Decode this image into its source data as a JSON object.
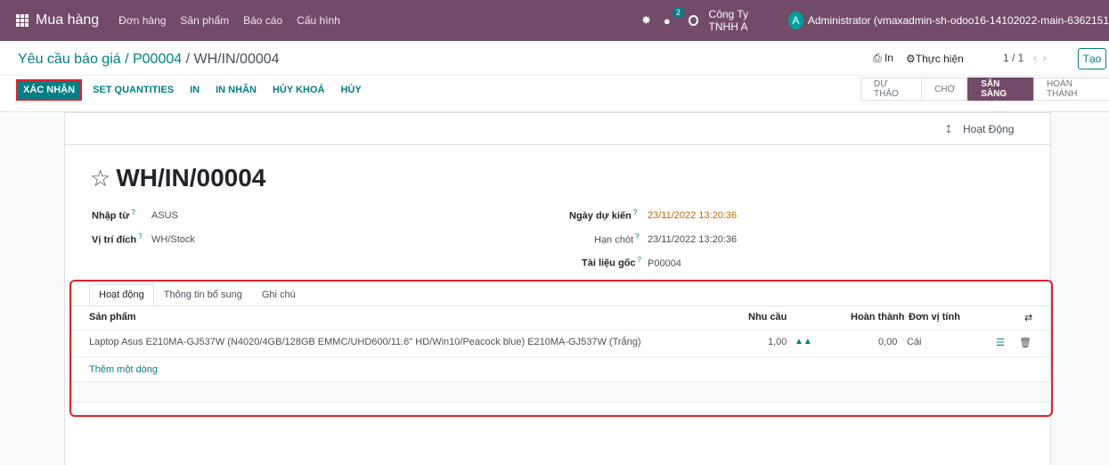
{
  "navbar": {
    "brand": "Mua hàng",
    "menus": [
      "Đơn hàng",
      "Sản phẩm",
      "Báo cáo",
      "Cấu hình"
    ],
    "chat_count": "2",
    "company": "Công Ty TNHH A",
    "avatar_letter": "A",
    "user": "Administrator (vmaxadmin-sh-odoo16-14102022-main-6362151"
  },
  "control_panel": {
    "breadcrumb_parent": "Yêu cầu báo giá / P00004",
    "breadcrumb_current": " / WH/IN/00004",
    "print_label": "In",
    "action_label": "Thực hiện",
    "pager": "1 / 1",
    "create_label": "Tạo"
  },
  "buttons": {
    "confirm": "XÁC NHẬN",
    "set_quantities": "SET QUANTITIES",
    "print": "IN",
    "print_labels": "IN NHÃN",
    "unlock": "HỦY KHOÁ",
    "cancel": "HỦY"
  },
  "status": [
    "DỰ THẢO",
    "CHỜ",
    "SẴN SÀNG",
    "HOÀN THÀNH"
  ],
  "status_active": "SẴN SÀNG",
  "sheet": {
    "activity_label": "Hoạt Động",
    "title": "WH/IN/00004",
    "fields": {
      "partner_label": "Nhập từ",
      "partner_value": "ASUS",
      "dest_label": "Vị trí đích",
      "dest_value": "WH/Stock",
      "scheduled_label": "Ngày dự kiến",
      "scheduled_value": "23/11/2022 13:20:36",
      "deadline_label": "Hạn chót",
      "deadline_value": "23/11/2022 13:20:36",
      "origin_label": "Tài liệu gốc",
      "origin_value": "P00004"
    },
    "tabs": [
      "Hoạt động",
      "Thông tin bổ sung",
      "Ghi chú"
    ],
    "table": {
      "headers": [
        "Sản phẩm",
        "Nhu cầu",
        "Hoàn thành",
        "Đơn vị tính"
      ],
      "rows": [
        {
          "product": "Laptop Asus E210MA-GJ537W (N4020/4GB/128GB EMMC/UHD600/11.6\" HD/Win10/Peacock blue) E210MA-GJ537W (Trắng)",
          "demand": "1,00",
          "done": "0,00",
          "uom": "Cái"
        }
      ],
      "add_line": "Thêm một dòng"
    }
  }
}
